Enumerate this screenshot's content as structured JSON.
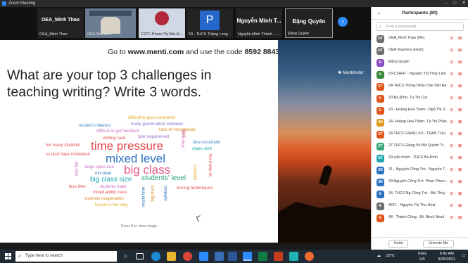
{
  "window": {
    "title": "Zoom Meeting",
    "controls": [
      "–",
      "□",
      "✕"
    ]
  },
  "gallery": {
    "tiles": [
      {
        "name": "OEA_Minh Thao",
        "big": "OEA_Minh Thao"
      },
      {
        "name": "OEA Teachers"
      },
      {
        "name": "C2TC-Phạm Thị Mai H..."
      },
      {
        "name": "59 - THCS Thắng Long...",
        "letter": "P"
      },
      {
        "name": "Nguyễn Minh Thành - ...",
        "big": "Nguyễn Minh T..."
      },
      {
        "name": "Đặng Quyên",
        "big": "Đặng Quyên"
      }
    ],
    "next_icon": "chevron-right-icon"
  },
  "slide": {
    "goto_prefix": "Go to ",
    "goto_url": "www.menti.com",
    "goto_middle": " and use the code ",
    "goto_code": "8592 8843",
    "question_line1": "What are your top 3 challenges in",
    "question_line2": "teaching writing? Write 3 words.",
    "press_hint": "Press B to show image",
    "brand": "Mentimeter",
    "words": [
      {
        "text": "difficult to give comments",
        "color": "#e0a81f"
      },
      {
        "text": "many grammatical mistakes",
        "color": "#7f6cc8"
      },
      {
        "text": "student's interest",
        "color": "#3b7fc4"
      },
      {
        "text": "difficult to get feedback",
        "color": "#c46dc4"
      },
      {
        "text": "lack of vocabulary",
        "color": "#d98a22"
      },
      {
        "text": "writing task",
        "color": "#e24b4b"
      },
      {
        "text": "task requirement",
        "color": "#9b6fd0"
      },
      {
        "text": "too many students",
        "color": "#e24b4b"
      },
      {
        "text": "time pressure",
        "color": "#e24b4b"
      },
      {
        "text": "time constraint",
        "color": "#3b7fc4"
      },
      {
        "text": "class size",
        "color": "#1fa8b2"
      },
      {
        "text": "ss dont have motivation",
        "color": "#e24b4b"
      },
      {
        "text": "mixed level",
        "color": "#2a72c0"
      },
      {
        "text": "time",
        "color": "#e24b4b"
      },
      {
        "text": "large class size",
        "color": "#c46dc4"
      },
      {
        "text": "big class",
        "color": "#e35a8c"
      },
      {
        "text": "big size",
        "color": "#c46dc4"
      },
      {
        "text": "mix level",
        "color": "#2a72c0"
      },
      {
        "text": "big class size",
        "color": "#1fa8b2"
      },
      {
        "text": "students' level",
        "color": "#2ea87a"
      },
      {
        "text": "less time",
        "color": "#e24b4b"
      },
      {
        "text": "students habit",
        "color": "#c46dc4"
      },
      {
        "text": "mixed ability class",
        "color": "#e24b4b"
      },
      {
        "text": "students cooperation",
        "color": "#d98a22"
      },
      {
        "text": "lesson is too long",
        "color": "#e3a81f"
      },
      {
        "text": "boring techniques",
        "color": "#e24b4b"
      },
      {
        "text": "time limit",
        "color": "#c46dc4"
      },
      {
        "text": "too many ss",
        "color": "#e24b4b"
      },
      {
        "text": "crowded",
        "color": "#e3a81f"
      },
      {
        "text": "waste time",
        "color": "#2a72c0"
      },
      {
        "text": "big class",
        "color": "#d98a22"
      },
      {
        "text": "syllabus",
        "color": "#2a72c0"
      }
    ]
  },
  "participants": {
    "title": "Participants (80)",
    "search_placeholder": "Find a participant",
    "list": [
      {
        "initials": "OT",
        "name": "OEA_Minh Thao (Me)",
        "color": "#6e6e6e"
      },
      {
        "initials": "OT",
        "name": "OEA Teachers (Host)",
        "color": "#6e6e6e"
      },
      {
        "initials": "Đ",
        "name": "Đặng Quyên",
        "color": "#8c4fc4"
      },
      {
        "initials": "0-",
        "name": "03-C2HHT - Nguyễn Thị Thúy Liên",
        "color": "#3a8c3a"
      },
      {
        "initials": "0T",
        "name": "04-THCS Thống Nhất-Trần Việt Hà",
        "color": "#e0561d"
      },
      {
        "initials": "2-",
        "name": "20-Ba Đình- Tạ Thị Cúc",
        "color": "#e0561d"
      },
      {
        "initials": "2-",
        "name": "23.- Hoàng Hoa Thám - Ngô Thị X...",
        "color": "#e0561d"
      },
      {
        "initials": "2H",
        "name": "24- Hoàng Hoa Thám- Tạ Thị Phán",
        "color": "#e09a1d"
      },
      {
        "initials": "2T",
        "name": "24.THCS GIẢNG VÕ - TRẦN THU...",
        "color": "#e0561d"
      },
      {
        "initials": "2T",
        "name": "27.THCS Giảng Võ-Bùi Quỳnh Tr...",
        "color": "#3aa87a"
      },
      {
        "initials": "2C",
        "name": "29-việt chính - THCS Ba Đình",
        "color": "#1fa8b2"
      },
      {
        "initials": "3N",
        "name": "31.- Nguyễn Công Trứ - Nguyễn T...",
        "color": "#2a72c0"
      },
      {
        "initials": "3N",
        "name": "33.Nguyễn Công Trứ- Phan Phươ...",
        "color": "#2a72c0"
      },
      {
        "initials": "3-",
        "name": "34. THCS Ng Công Trứ - Bùi Thủy",
        "color": "#2a72c0"
      },
      {
        "initials": "4-",
        "name": "46TL - Nguyễn Thị Thu Hoài",
        "color": "#6e6e6e"
      },
      {
        "initials": "4-",
        "name": "48 - Thành Công - Đỗ Nhuệ Nhuệ",
        "color": "#e0561d"
      }
    ],
    "invite_label": "Invite",
    "unmute_label": "Unmute Me"
  },
  "taskbar": {
    "search_placeholder": "Type here to search",
    "temperature": "23°C",
    "lang_top": "ENG",
    "lang_bottom": "US",
    "time": "8:41 AM",
    "date": "9/25/2021"
  }
}
